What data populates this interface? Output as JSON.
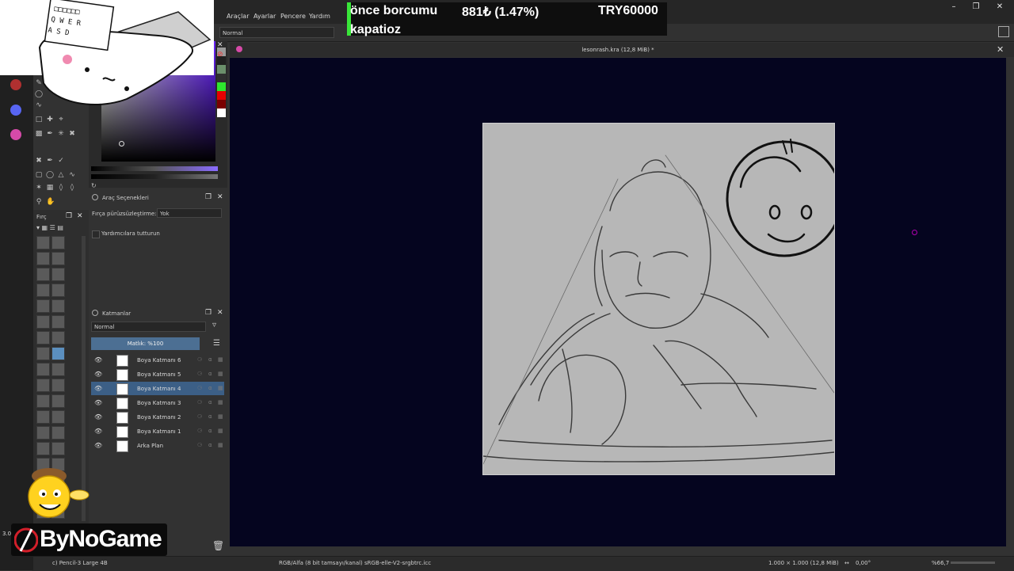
{
  "app": {
    "menu": [
      "Araçlar",
      "Ayarlar",
      "Pencere",
      "Yardım"
    ],
    "document_title": "lesonrash.kra (12,8 MiB) *",
    "blend_mode": "Normal"
  },
  "tool_options": {
    "title": "Araç Seçenekleri",
    "smoothing_label": "Fırça pürüzsüzleştirme:",
    "smoothing_value": "Yok",
    "assistant_label": "Yardımcılara tutturun"
  },
  "brushes": {
    "title": "Fırç"
  },
  "layers": {
    "title": "Katmanlar",
    "blend_mode": "Normal",
    "opacity": "Matlık: %100",
    "items": [
      {
        "name": "Boya Katmanı 6",
        "active": false
      },
      {
        "name": "Boya Katmanı 5",
        "active": false
      },
      {
        "name": "Boya Katmanı 4",
        "active": true
      },
      {
        "name": "Boya Katmanı 3",
        "active": false
      },
      {
        "name": "Boya Katmanı 2",
        "active": false
      },
      {
        "name": "Boya Katmanı 1",
        "active": false
      },
      {
        "name": "Arka Plan",
        "active": false
      }
    ]
  },
  "status": {
    "brush": "c) Pencil-3 Large 4B",
    "color_profile": "RGB/Alfa (8 bit tamsayı/kanal) sRGB-elle-V2-srgbtrc.icc",
    "canvas_size": "1.000 × 1.000 (12,8 MiB)",
    "rotation": "0,00°",
    "zoom": "%66,7"
  },
  "overlay": {
    "ticker_line1": "önce borcumu",
    "ticker_amount": "881₺ (1.47%)",
    "ticker_goal": "TRY60000",
    "ticker_line2": "kapatioz",
    "logo": "ByNoGame",
    "side_value": "3.0"
  },
  "colors": {
    "canvas_bg": "#05051f",
    "paper": "#b7b7b7",
    "active_layer": "#3c5f86",
    "accent_green": "#39e639",
    "swatches": [
      "#9a9a9a",
      "#202020",
      "#6b8f6b",
      "#2f2f2f",
      "#2ee62e",
      "#e60000",
      "#7a0000",
      "#ffffff"
    ]
  }
}
